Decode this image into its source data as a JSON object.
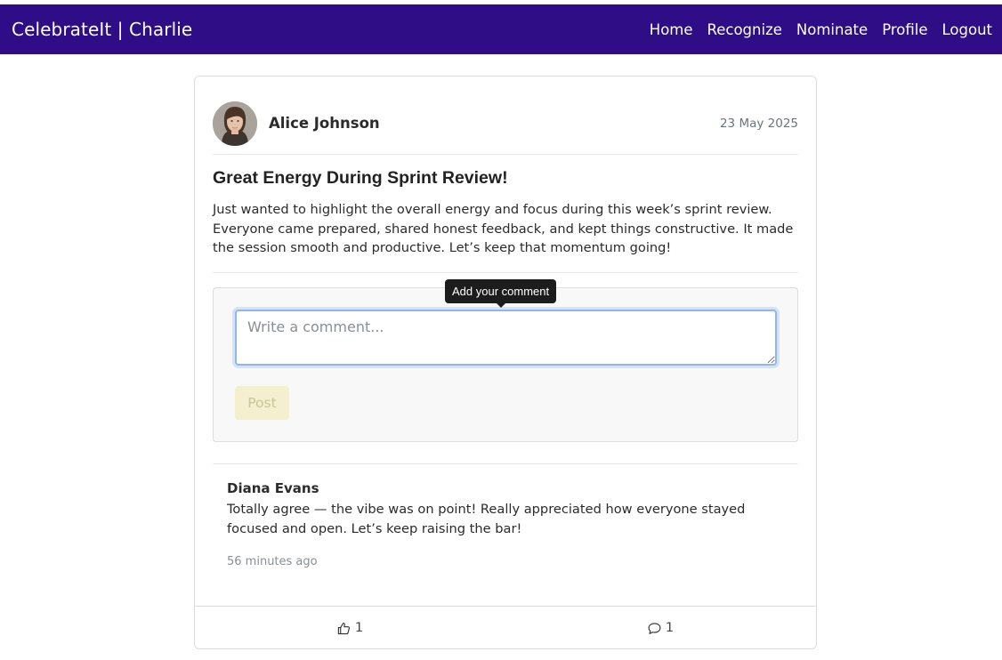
{
  "navbar": {
    "brand": "CelebrateIt | Charlie",
    "links": [
      "Home",
      "Recognize",
      "Nominate",
      "Profile",
      "Logout"
    ],
    "background": "#2e0d87"
  },
  "post": {
    "author": "Alice Johnson",
    "date": "23 May 2025",
    "title": "Great Energy During Sprint Review!",
    "body": "Just wanted to highlight the overall energy and focus during this week’s sprint review. Everyone came prepared, shared honest feedback, and kept things constructive. It made the session smooth and productive. Let’s keep that momentum going!"
  },
  "comment_form": {
    "tooltip": "Add your comment",
    "placeholder": "Write a comment...",
    "value": "",
    "post_label": "Post"
  },
  "comments": [
    {
      "author": "Diana Evans",
      "text": "Totally agree — the vibe was on point! Really appreciated how everyone stayed focused and open. Let’s keep raising the bar!",
      "time": "56 minutes ago"
    }
  ],
  "footer": {
    "like_icon": "thumbs-up-icon",
    "like_count": "1",
    "comment_icon": "speech-bubble-icon",
    "comment_count": "1"
  }
}
